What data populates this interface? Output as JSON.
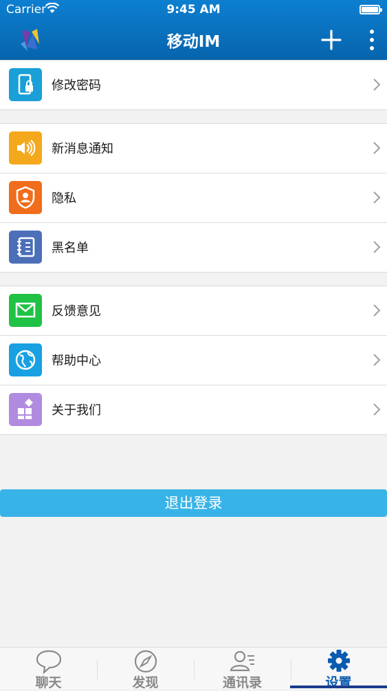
{
  "status_bar": {
    "carrier": "Carrier",
    "time": "9:45 AM"
  },
  "header": {
    "title": "移动IM",
    "icons": [
      "app-logo-icon",
      "plus-icon",
      "more-vertical-icon"
    ]
  },
  "settings": {
    "group1": [
      {
        "label": "修改密码",
        "icon": "phone-lock-icon",
        "color": "#1a9fd6"
      }
    ],
    "group2": [
      {
        "label": "新消息通知",
        "icon": "speaker-icon",
        "color": "#f4a81c"
      },
      {
        "label": "隐私",
        "icon": "privacy-shield-icon",
        "color": "#f06d1b"
      },
      {
        "label": "黑名单",
        "icon": "contact-book-icon",
        "color": "#4c6fb7"
      }
    ],
    "group3": [
      {
        "label": "反馈意见",
        "icon": "mail-icon",
        "color": "#1fc244"
      },
      {
        "label": "帮助中心",
        "icon": "globe-icon",
        "color": "#18a0e3"
      },
      {
        "label": "关于我们",
        "icon": "apps-icon",
        "color": "#b08be0"
      }
    ]
  },
  "logout_label": "退出登录",
  "tabs": [
    {
      "label": "聊天",
      "icon": "chat-bubble-icon"
    },
    {
      "label": "发现",
      "icon": "compass-icon"
    },
    {
      "label": "通讯录",
      "icon": "contacts-icon"
    },
    {
      "label": "设置",
      "icon": "gear-icon",
      "active": true
    }
  ],
  "colors": {
    "header": "#0a72c1",
    "logout": "#38b3e8",
    "active_tab": "#0a5bb0"
  }
}
